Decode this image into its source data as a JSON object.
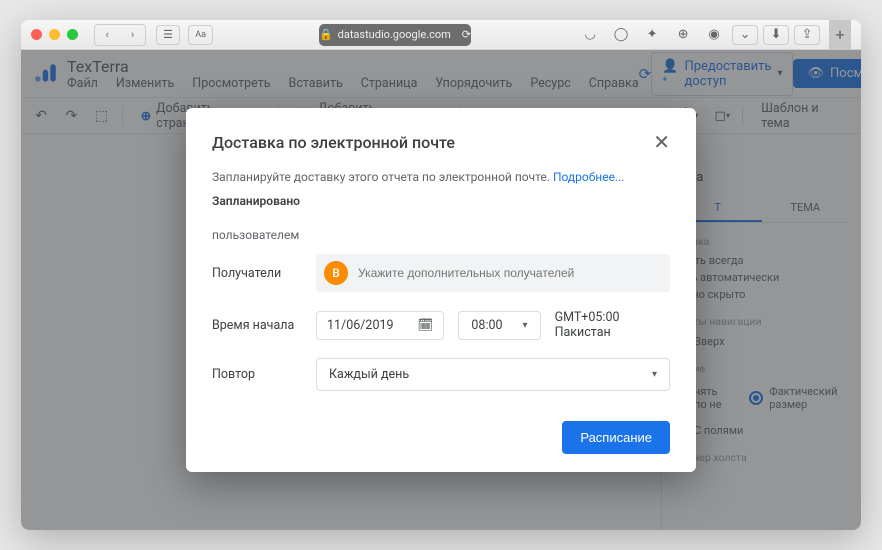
{
  "browser": {
    "url": "datastudio.google.com"
  },
  "header": {
    "brand": "TexTerra",
    "share_label": "Предоставить доступ",
    "view_label": "Посмотреть"
  },
  "menus": [
    "Файл",
    "Изменить",
    "Просмотреть",
    "Вставить",
    "Страница",
    "Упорядочить",
    "Ресурс",
    "Справка"
  ],
  "toolbar": {
    "add_page": "Добавить страницу",
    "add_chart": "Добавить диаграмму",
    "theme": "Шаблон и тема"
  },
  "sidepanel": {
    "title": "тема",
    "tab1": "Т",
    "tab2": "ТЕМА",
    "section_header": "оловка",
    "opt_always_show": "ывать всегда",
    "opt_auto_hide": "вать автоматически",
    "opt_initial_hidden": "ально скрыто",
    "section_nav": "менты навигации",
    "nav_top": "Вверх",
    "section_display": "жение",
    "fit_width": "нять по не",
    "actual_size": "Фактический размер",
    "with_margins": "С полями",
    "canvas_size": "Размер холста"
  },
  "modal": {
    "title": "Доставка по электронной почте",
    "description": "Запланируйте доставку этого отчета по электронной почте.",
    "learn_more": "Подробнее...",
    "scheduled": "Запланировано",
    "by_user": "пользователем",
    "recipients_label": "Получатели",
    "recipient_initial": "B",
    "recipient_placeholder": "Укажите дополнительных получателей",
    "start_time_label": "Время начала",
    "date_value": "11/06/2019",
    "time_value": "08:00",
    "timezone": "GMT+05:00 Пакистан",
    "repeat_label": "Повтор",
    "repeat_value": "Каждый день",
    "submit": "Расписание"
  }
}
